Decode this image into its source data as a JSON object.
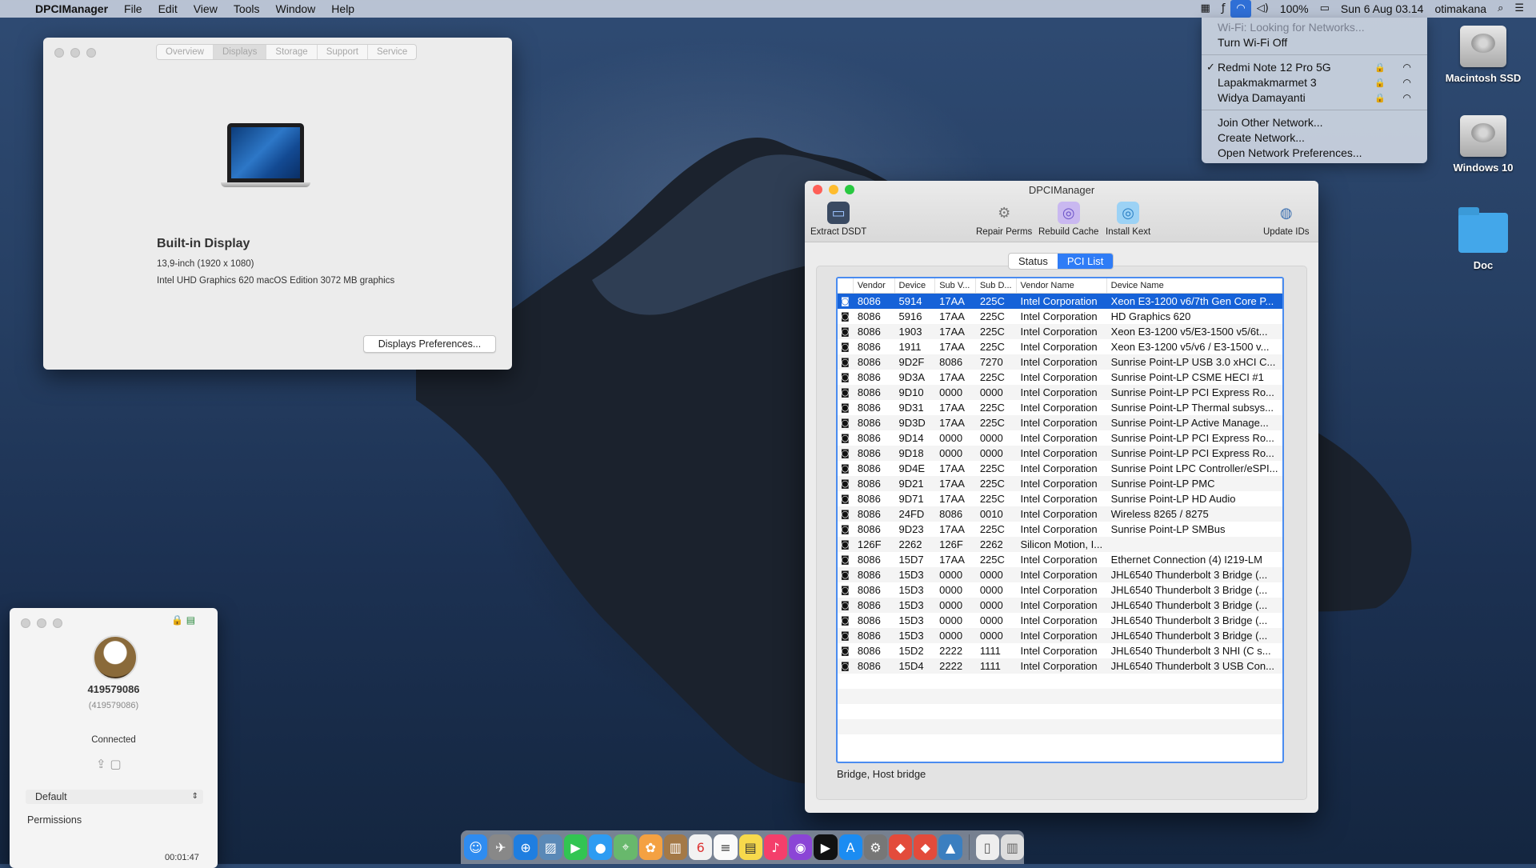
{
  "menubar": {
    "app_name": "DPCIManager",
    "menus": [
      "File",
      "Edit",
      "View",
      "Tools",
      "Window",
      "Help"
    ],
    "battery": "100%",
    "datetime": "Sun 6 Aug  03.14",
    "user": "otimakana"
  },
  "wifi_menu": {
    "status": "Wi-Fi: Looking for Networks...",
    "toggle": "Turn Wi-Fi Off",
    "networks": [
      {
        "name": "Redmi Note 12 Pro 5G",
        "connected": true
      },
      {
        "name": "Lapakmakmarmet 3",
        "connected": false
      },
      {
        "name": "Widya Damayanti",
        "connected": false
      }
    ],
    "actions": [
      "Join Other Network...",
      "Create Network...",
      "Open Network Preferences..."
    ]
  },
  "desktop": {
    "icons": [
      "Macintosh SSD",
      "Windows 10",
      "Doc"
    ]
  },
  "about": {
    "tabs": [
      "Overview",
      "Displays",
      "Storage",
      "Support",
      "Service"
    ],
    "selected_tab": "Displays",
    "display_title": "Built-in Display",
    "display_size": "13,9-inch (1920 x 1080)",
    "graphics": "Intel UHD Graphics 620 macOS Edition 3072 MB graphics",
    "prefs_button": "Displays Preferences..."
  },
  "dpci": {
    "title": "DPCIManager",
    "tools": [
      "Extract DSDT",
      "Repair Perms",
      "Rebuild Cache",
      "Install Kext",
      "Update IDs"
    ],
    "tabs": [
      "Status",
      "PCI List"
    ],
    "selected_tab": "PCI List",
    "columns": [
      "Vendor",
      "Device",
      "Sub V...",
      "Sub D...",
      "Vendor Name",
      "Device Name"
    ],
    "rows": [
      [
        "8086",
        "5914",
        "17AA",
        "225C",
        "Intel Corporation",
        "Xeon E3-1200 v6/7th Gen Core P..."
      ],
      [
        "8086",
        "5916",
        "17AA",
        "225C",
        "Intel Corporation",
        "HD Graphics 620"
      ],
      [
        "8086",
        "1903",
        "17AA",
        "225C",
        "Intel Corporation",
        "Xeon E3-1200 v5/E3-1500 v5/6t..."
      ],
      [
        "8086",
        "1911",
        "17AA",
        "225C",
        "Intel Corporation",
        "Xeon E3-1200 v5/v6 / E3-1500 v..."
      ],
      [
        "8086",
        "9D2F",
        "8086",
        "7270",
        "Intel Corporation",
        "Sunrise Point-LP USB 3.0 xHCI C..."
      ],
      [
        "8086",
        "9D3A",
        "17AA",
        "225C",
        "Intel Corporation",
        "Sunrise Point-LP CSME HECI #1"
      ],
      [
        "8086",
        "9D10",
        "0000",
        "0000",
        "Intel Corporation",
        "Sunrise Point-LP PCI Express Ro..."
      ],
      [
        "8086",
        "9D31",
        "17AA",
        "225C",
        "Intel Corporation",
        "Sunrise Point-LP Thermal subsys..."
      ],
      [
        "8086",
        "9D3D",
        "17AA",
        "225C",
        "Intel Corporation",
        "Sunrise Point-LP Active Manage..."
      ],
      [
        "8086",
        "9D14",
        "0000",
        "0000",
        "Intel Corporation",
        "Sunrise Point-LP PCI Express Ro..."
      ],
      [
        "8086",
        "9D18",
        "0000",
        "0000",
        "Intel Corporation",
        "Sunrise Point-LP PCI Express Ro..."
      ],
      [
        "8086",
        "9D4E",
        "17AA",
        "225C",
        "Intel Corporation",
        "Sunrise Point LPC Controller/eSPI..."
      ],
      [
        "8086",
        "9D21",
        "17AA",
        "225C",
        "Intel Corporation",
        "Sunrise Point-LP PMC"
      ],
      [
        "8086",
        "9D71",
        "17AA",
        "225C",
        "Intel Corporation",
        "Sunrise Point-LP HD Audio"
      ],
      [
        "8086",
        "24FD",
        "8086",
        "0010",
        "Intel Corporation",
        "Wireless 8265 / 8275"
      ],
      [
        "8086",
        "9D23",
        "17AA",
        "225C",
        "Intel Corporation",
        "Sunrise Point-LP SMBus"
      ],
      [
        "126F",
        "2262",
        "126F",
        "2262",
        "Silicon Motion, I...",
        ""
      ],
      [
        "8086",
        "15D7",
        "17AA",
        "225C",
        "Intel Corporation",
        "Ethernet Connection (4) I219-LM"
      ],
      [
        "8086",
        "15D3",
        "0000",
        "0000",
        "Intel Corporation",
        "JHL6540 Thunderbolt 3 Bridge (..."
      ],
      [
        "8086",
        "15D3",
        "0000",
        "0000",
        "Intel Corporation",
        "JHL6540 Thunderbolt 3 Bridge (..."
      ],
      [
        "8086",
        "15D3",
        "0000",
        "0000",
        "Intel Corporation",
        "JHL6540 Thunderbolt 3 Bridge (..."
      ],
      [
        "8086",
        "15D3",
        "0000",
        "0000",
        "Intel Corporation",
        "JHL6540 Thunderbolt 3 Bridge (..."
      ],
      [
        "8086",
        "15D3",
        "0000",
        "0000",
        "Intel Corporation",
        "JHL6540 Thunderbolt 3 Bridge (..."
      ],
      [
        "8086",
        "15D2",
        "2222",
        "1111",
        "Intel Corporation",
        "JHL6540 Thunderbolt 3 NHI (C s..."
      ],
      [
        "8086",
        "15D4",
        "2222",
        "1111",
        "Intel Corporation",
        "JHL6540 Thunderbolt 3 USB Con..."
      ]
    ],
    "selected_row": 0,
    "status_text": "Bridge, Host bridge"
  },
  "remote": {
    "id": "419579086",
    "id_paren": "(419579086)",
    "status": "Connected",
    "profile": "Default",
    "permissions": "Permissions",
    "timer": "00:01:47"
  }
}
